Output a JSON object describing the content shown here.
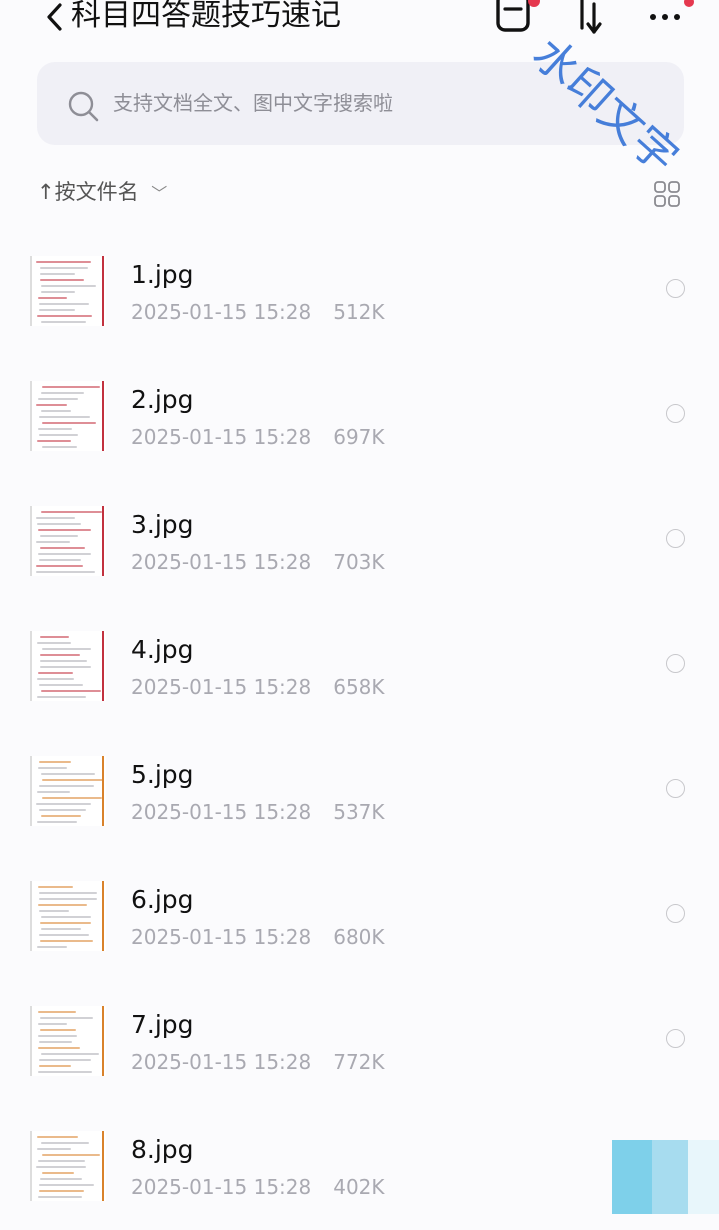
{
  "header": {
    "title": "科目四答题技巧速记",
    "icons": [
      "back-chevron-icon",
      "file-box-icon",
      "sort-arrows-icon",
      "more-icon"
    ],
    "badge_color": "#e5384f"
  },
  "search": {
    "placeholder": "支持文档全文、图中文字搜索啦"
  },
  "sortbar": {
    "arrow": "↑",
    "label": "按文件名",
    "chevron": "﹀"
  },
  "watermark": {
    "text": "水印文字",
    "color": "#2f6fd6"
  },
  "files": [
    {
      "name": "1.jpg",
      "date": "2025-01-15 15:28",
      "size": "512K",
      "accent": "#c2313f"
    },
    {
      "name": "2.jpg",
      "date": "2025-01-15 15:28",
      "size": "697K",
      "accent": "#c2313f"
    },
    {
      "name": "3.jpg",
      "date": "2025-01-15 15:28",
      "size": "703K",
      "accent": "#c2313f"
    },
    {
      "name": "4.jpg",
      "date": "2025-01-15 15:28",
      "size": "658K",
      "accent": "#c2313f"
    },
    {
      "name": "5.jpg",
      "date": "2025-01-15 15:28",
      "size": "537K",
      "accent": "#d9822b"
    },
    {
      "name": "6.jpg",
      "date": "2025-01-15 15:28",
      "size": "680K",
      "accent": "#d9822b"
    },
    {
      "name": "7.jpg",
      "date": "2025-01-15 15:28",
      "size": "772K",
      "accent": "#d9822b"
    },
    {
      "name": "8.jpg",
      "date": "2025-01-15 15:28",
      "size": "402K",
      "accent": "#d9822b"
    }
  ],
  "colors": {
    "background": "#fbfbfd",
    "search_bg": "#f0f0f6",
    "meta_text": "#a9a9b1"
  }
}
